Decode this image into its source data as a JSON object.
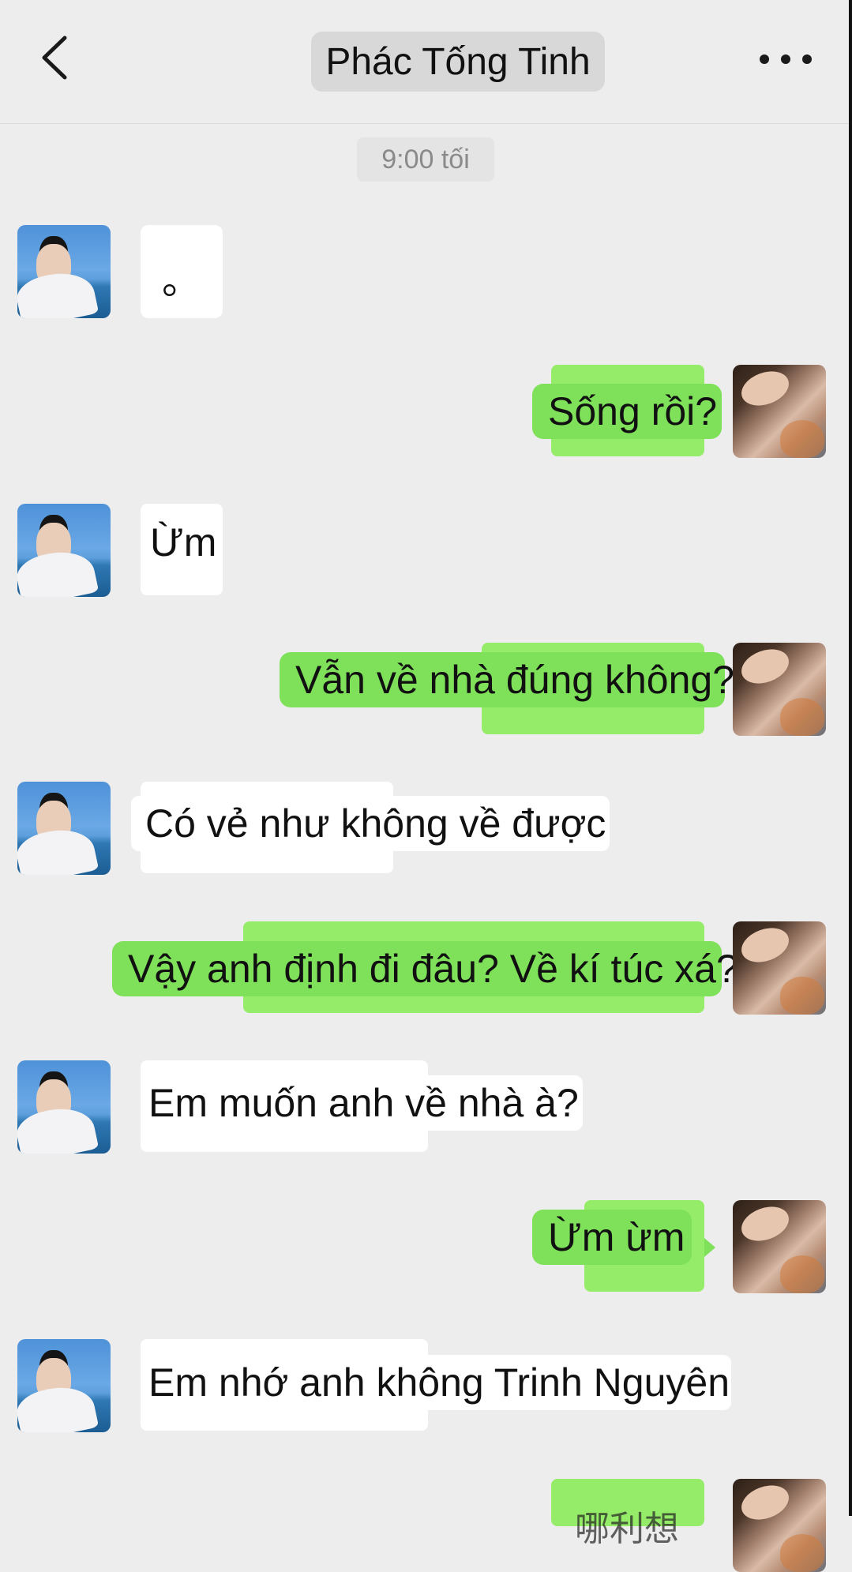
{
  "header": {
    "title": "Phác Tống Tinh",
    "back_icon": "chevron-left-icon",
    "more_icon": "more-horizontal-icon"
  },
  "timestamp": "9:00 tối",
  "messages": [
    {
      "side": "in",
      "text": "。"
    },
    {
      "side": "out",
      "text": "Sống rồi?"
    },
    {
      "side": "in",
      "text": "Ừm"
    },
    {
      "side": "out",
      "text": "Vẫn về nhà đúng không?"
    },
    {
      "side": "in",
      "text": "Có vẻ như không về được"
    },
    {
      "side": "out",
      "text": "Vậy anh định đi đâu? Về kí túc xá?"
    },
    {
      "side": "in",
      "text": "Em muốn anh về nhà à?"
    },
    {
      "side": "out",
      "text": "Ừm ừm"
    },
    {
      "side": "in",
      "text": "Em nhớ anh không Trinh Nguyên"
    },
    {
      "side": "out",
      "text": "哪利想"
    }
  ],
  "colors": {
    "background": "#ededed",
    "outgoing_bubble": "#7fe05a",
    "incoming_bubble": "#ffffff",
    "timestamp_text": "#8a8a8a"
  }
}
